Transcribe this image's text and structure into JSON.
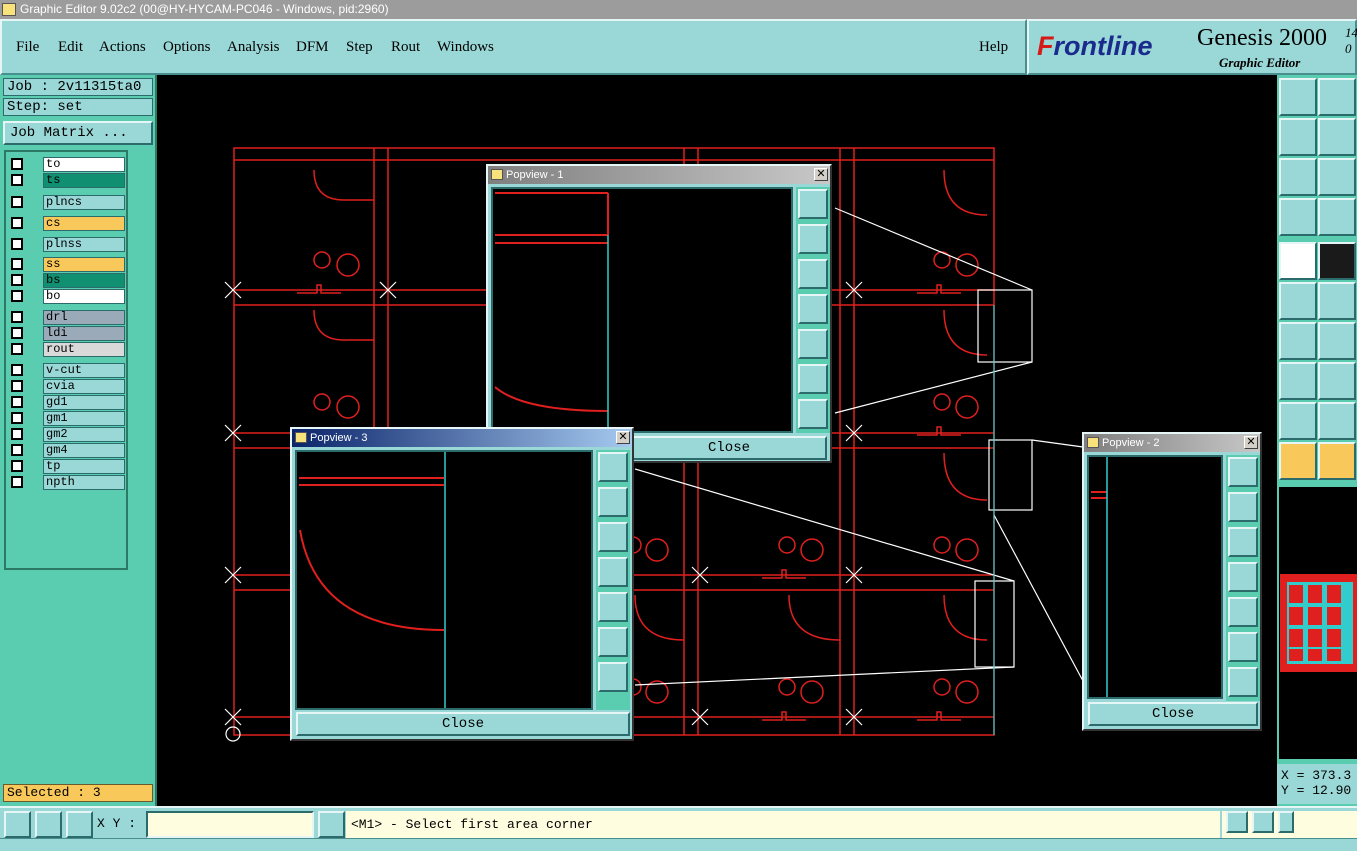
{
  "window": {
    "title": "Graphic Editor 9.02c2 (00@HY-HYCAM-PC046 - Windows, pid:2960)"
  },
  "menu": [
    "File",
    "Edit",
    "Actions",
    "Options",
    "Analysis",
    "DFM",
    "Step",
    "Rout",
    "Windows"
  ],
  "help_label": "Help",
  "logo": {
    "brand_prefix": "F",
    "brand_rest": "rontline",
    "product": "Genesis 2000",
    "subtitle": "Graphic Editor",
    "version_top": "14",
    "version_bottom": "0"
  },
  "job": {
    "job_label": "Job : 2v11315ta0",
    "step_label": "Step: set",
    "job_matrix": "Job Matrix ..."
  },
  "layers": [
    {
      "name": "to",
      "color": "#ffffff"
    },
    {
      "name": "ts",
      "color": "#109070"
    },
    {
      "name": "plncs",
      "color": "#9ad7d7"
    },
    {
      "name": "cs",
      "color": "#f9c85a"
    },
    {
      "name": "plnss",
      "color": "#9ad7d7"
    },
    {
      "name": "ss",
      "color": "#f9c85a"
    },
    {
      "name": "bs",
      "color": "#109070"
    },
    {
      "name": "bo",
      "color": "#ffffff"
    },
    {
      "name": "drl",
      "color": "#9aaab8"
    },
    {
      "name": "ldi",
      "color": "#9aaab8"
    },
    {
      "name": "rout",
      "color": "#d9d9d9"
    },
    {
      "name": "v-cut",
      "color": "#9ad7d7"
    },
    {
      "name": "cvia",
      "color": "#9ad7d7"
    },
    {
      "name": "gd1",
      "color": "#9ad7d7"
    },
    {
      "name": "gm1",
      "color": "#9ad7d7"
    },
    {
      "name": "gm2",
      "color": "#9ad7d7"
    },
    {
      "name": "gm4",
      "color": "#9ad7d7"
    },
    {
      "name": "tp",
      "color": "#9ad7d7"
    },
    {
      "name": "npth",
      "color": "#9ad7d7"
    }
  ],
  "selected": "Selected : 3",
  "popviews": [
    {
      "title": "Popview - 1",
      "close": "Close"
    },
    {
      "title": "Popview - 3",
      "close": "Close"
    },
    {
      "title": "Popview - 2",
      "close": "Close"
    }
  ],
  "coords": {
    "x": "X = 373.3",
    "y": "Y = 12.90"
  },
  "bottom": {
    "xy_label": "X Y :",
    "xy_value": "",
    "message": "<M1> - Select first area corner"
  },
  "colors": {
    "panel": "#9ad7d7",
    "pane": "#5acdb0",
    "drawing_red": "#e0201e",
    "cyan_line": "#33cccc"
  }
}
